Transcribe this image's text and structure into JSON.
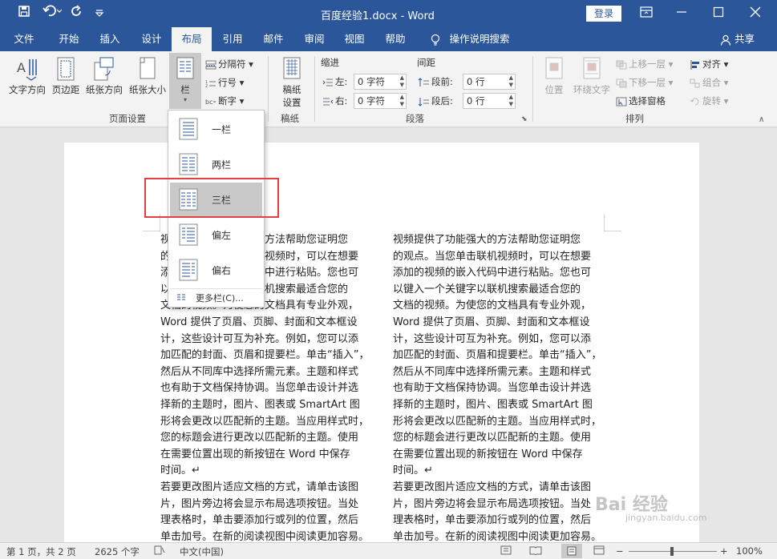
{
  "titlebar": {
    "title": "百度经验1.docx  -  Word",
    "login": "登录",
    "save_icon": "save-icon",
    "undo_icon": "undo-icon",
    "redo_icon": "redo-icon"
  },
  "tabs": [
    {
      "label": "文件"
    },
    {
      "label": "开始"
    },
    {
      "label": "插入"
    },
    {
      "label": "设计"
    },
    {
      "label": "布局"
    },
    {
      "label": "引用"
    },
    {
      "label": "邮件"
    },
    {
      "label": "审阅"
    },
    {
      "label": "视图"
    },
    {
      "label": "帮助"
    },
    {
      "label": "操作说明搜索"
    }
  ],
  "share": "共享",
  "ribbon": {
    "page_setup": {
      "text_direction": "文字方向",
      "margins": "页边距",
      "orientation": "纸张方向",
      "size": "纸张大小",
      "columns": "栏",
      "breaks": "分隔符",
      "line_numbers": "行号",
      "hyphenation": "断字",
      "group_label": "页面设置"
    },
    "draft": {
      "button": "稿纸设置",
      "button_line1": "稿纸",
      "button_line2": "设置",
      "group_label": "稿纸"
    },
    "paragraph": {
      "indent_title": "缩进",
      "spacing_title": "间距",
      "left_label": "左:",
      "right_label": "右:",
      "before_label": "段前:",
      "after_label": "段后:",
      "left_value": "0 字符",
      "right_value": "0 字符",
      "before_value": "0 行",
      "after_value": "0 行",
      "group_label": "段落"
    },
    "arrange": {
      "position": "位置",
      "wrap_text": "环绕文字",
      "bring_forward": "上移一层",
      "send_backward": "下移一层",
      "selection_pane": "选择窗格",
      "align": "对齐",
      "group": "组合",
      "rotate": "旋转",
      "group_label": "排列"
    }
  },
  "columns_menu": {
    "items": [
      {
        "label": "一栏"
      },
      {
        "label": "两栏"
      },
      {
        "label": "三栏"
      },
      {
        "label": "偏左"
      },
      {
        "label": "偏右"
      }
    ],
    "more": "更多栏(C)..."
  },
  "document": {
    "left_col_lines": [
      "视频提供了功能强大的方法帮助您证明您",
      "的观点。当您单击联机视频时，可以在想要",
      "添加的视频的嵌入代码中进行粘贴。您也可",
      "以键入一个关键字以联机搜索最适合您的",
      "文档的视频。为使您的文档具有专业外观，",
      "Word 提供了页眉、页脚、封面和文本框设",
      "计，这些设计可互为补充。例如，您可以添",
      "加匹配的封面、页眉和提要栏。单击“插入”，",
      "然后从不同库中选择所需元素。主题和样式",
      "也有助于文档保持协调。当您单击设计并选",
      "择新的主题时，图片、图表或 SmartArt 图",
      "形将会更改以匹配新的主题。当应用样式时，",
      "您的标题会进行更改以匹配新的主题。使用",
      "在需要位置出现的新按钮在 Word 中保存",
      "时间。↵",
      "若要更改图片适应文档的方式，请单击该图",
      "片，图片旁边将会显示布局选项按钮。当处",
      "理表格时，单击要添加行或列的位置，然后",
      "单击加号。在新的阅读视图中阅读更加容易。"
    ],
    "right_col_lines": [
      "视频提供了功能强大的方法帮助您证明您",
      "的观点。当您单击联机视频时，可以在想要",
      "添加的视频的嵌入代码中进行粘贴。您也可",
      "以键入一个关键字以联机搜索最适合您的",
      "文档的视频。为使您的文档具有专业外观，",
      "Word 提供了页眉、页脚、封面和文本框设",
      "计，这些设计可互为补充。例如，您可以添",
      "加匹配的封面、页眉和提要栏。单击“插入”，",
      "然后从不同库中选择所需元素。主题和样式",
      "也有助于文档保持协调。当您单击设计并选",
      "择新的主题时，图片、图表或 SmartArt 图",
      "形将会更改以匹配新的主题。当应用样式时，",
      "您的标题会进行更改以匹配新的主题。使用",
      "在需要位置出现的新按钮在 Word 中保存",
      "时间。↵",
      "若要更改图片适应文档的方式，请单击该图",
      "片，图片旁边将会显示布局选项按钮。当处",
      "理表格时，单击要添加行或列的位置，然后",
      "单击加号。在新的阅读视图中阅读更加容易。"
    ]
  },
  "watermark": {
    "text": "Bai 经验",
    "url": "jingyan.baidu.com"
  },
  "status": {
    "page": "第 1 页，共 2 页",
    "words": "2625 个字",
    "language": "中文(中国)",
    "zoom": "100%"
  },
  "colors": {
    "accent": "#2b579a",
    "highlight_box": "#e04040"
  }
}
